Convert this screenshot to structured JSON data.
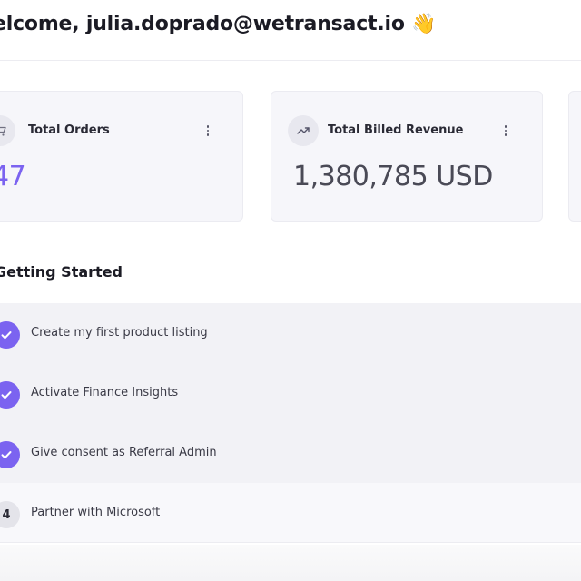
{
  "header": {
    "welcome_text": "elcome, julia.doprado@wetransact.io",
    "wave_emoji": "👋"
  },
  "cards": [
    {
      "title": "Total Orders",
      "value": "47",
      "icon": "cart-icon"
    },
    {
      "title": "Total Billed Revenue",
      "value": "1,380,785 USD",
      "icon": "trending-up-icon"
    }
  ],
  "getting_started": {
    "title": "Getting Started",
    "steps": [
      {
        "label": "Create my first product listing",
        "status": "done"
      },
      {
        "label": "Activate Finance Insights",
        "status": "done"
      },
      {
        "label": "Give consent as Referral Admin",
        "status": "done"
      },
      {
        "label": "Partner with Microsoft",
        "status": "todo",
        "number": "4"
      }
    ]
  },
  "colors": {
    "accent": "#7b63f0",
    "card_bg": "#f6f6fa",
    "text": "#1b1b24"
  }
}
